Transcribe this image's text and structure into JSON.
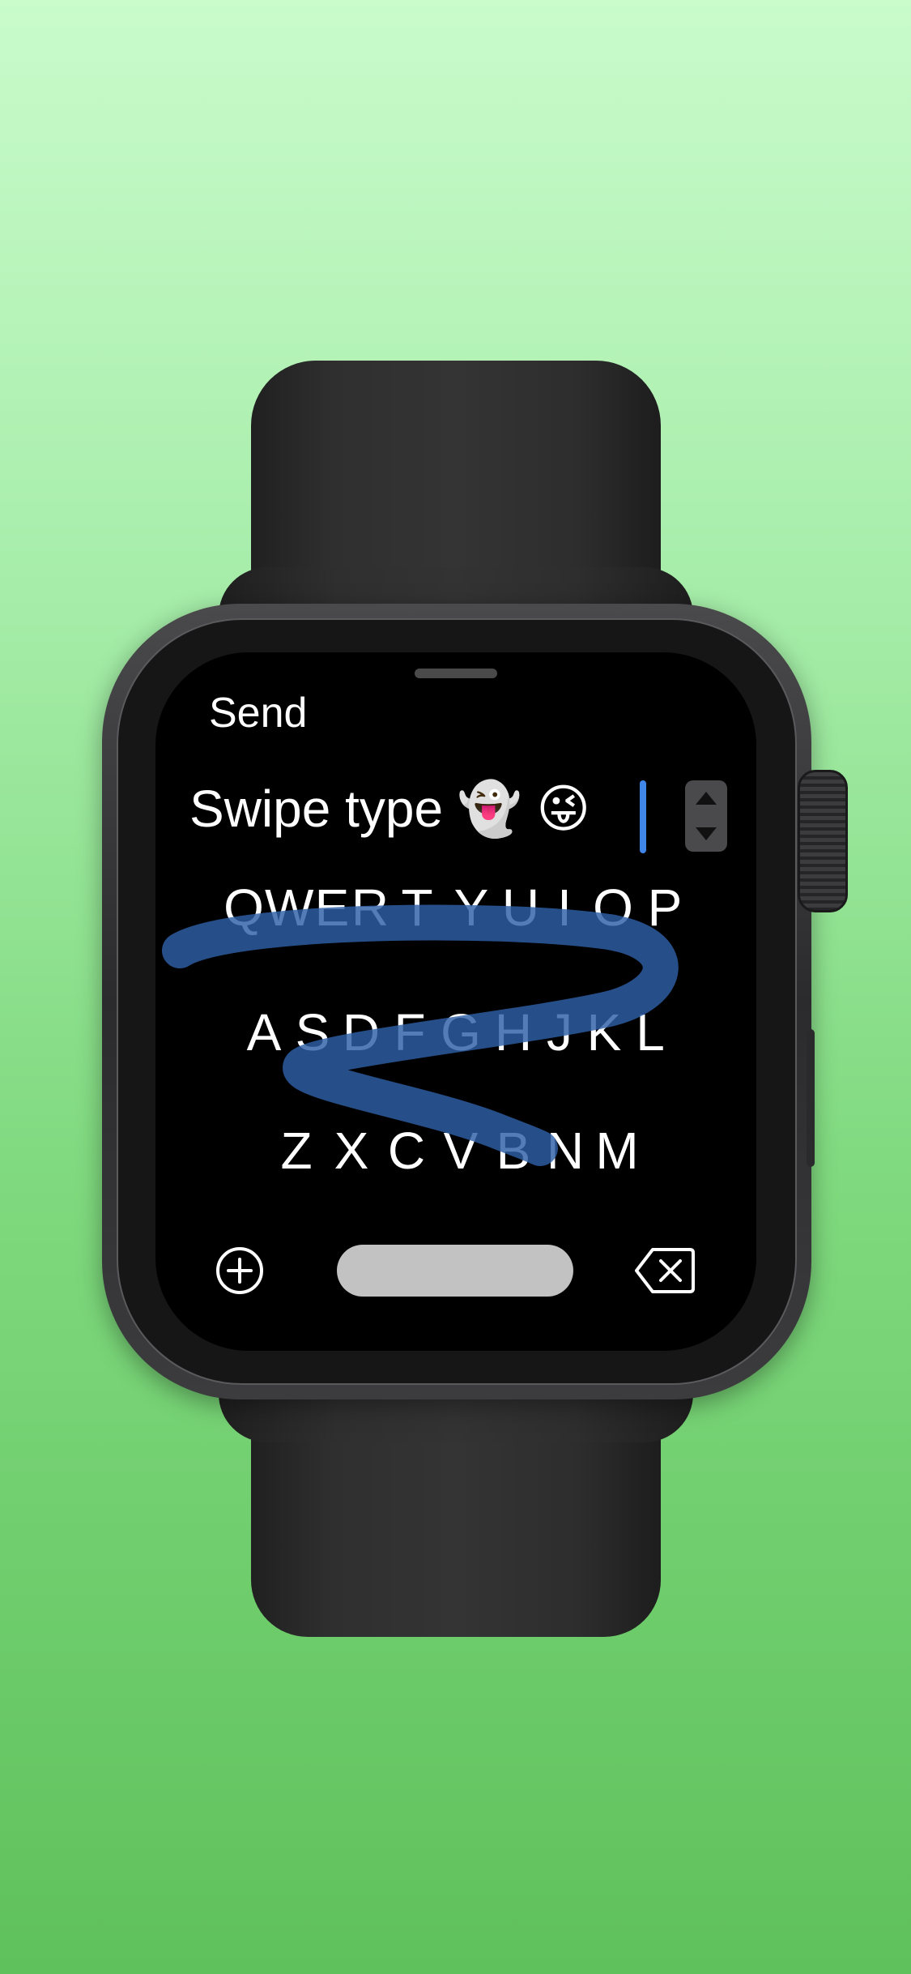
{
  "watch_app": {
    "send_label": "Send",
    "typed_text": "Swipe type 👻 😜",
    "keyboard": {
      "row1": [
        "Q",
        "W",
        "E",
        "R",
        "T",
        "Y",
        "U",
        "I",
        "O",
        "P"
      ],
      "row2": [
        "A",
        "S",
        "D",
        "F",
        "G",
        "H",
        "J",
        "K",
        "L"
      ],
      "row3": [
        "Z",
        "X",
        "C",
        "V",
        "B",
        "N",
        "M"
      ]
    },
    "icons": {
      "add": "plus-circle-icon",
      "delete": "delete-backward-icon",
      "stepper": "up-down-stepper-icon"
    },
    "colors": {
      "background_top": "#c9fbcb",
      "background_bottom": "#5fc15b",
      "screen": "#000000",
      "cursor": "#3f86e8",
      "swipe_trail": "#2e5fa6",
      "space_bar": "#c2c2c2"
    }
  }
}
